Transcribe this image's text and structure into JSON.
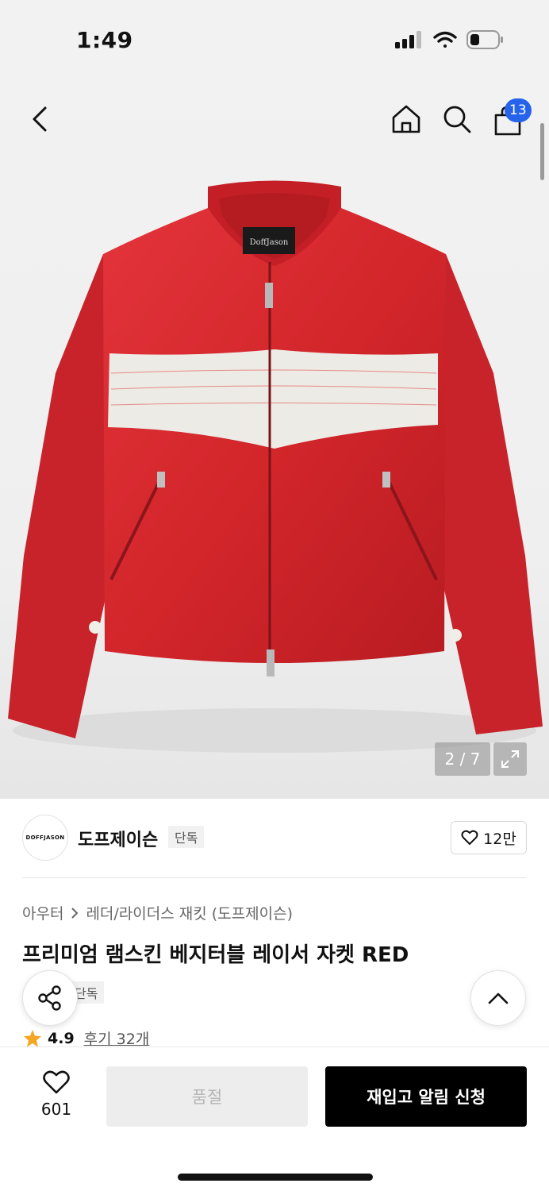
{
  "status_bar": {
    "time": "1:49"
  },
  "nav": {
    "cart_count": "13"
  },
  "gallery": {
    "counter": "2 / 7",
    "jacket_logo": "DoffJason"
  },
  "brand": {
    "logo_text": "DOFFJASON",
    "name": "도프제이슨",
    "tag": "단독",
    "likes": "12만"
  },
  "breadcrumb": {
    "category": "아우터",
    "subcategory": "레더/라이더스 재킷 (도프제이슨)"
  },
  "product": {
    "title": "프리미엄 램스킨 베지터블 레이서 자켓 RED",
    "sub_tag": "단독",
    "rating": "4.9",
    "reviews": "후기 32개"
  },
  "bottom_bar": {
    "wish_count": "601",
    "soldout_label": "품절",
    "restock_label": "재입고 알림 신청"
  },
  "colors": {
    "accent_badge": "#2563eb",
    "jacket_red": "#d4242a",
    "star": "#f5a623"
  },
  "icons": [
    "chevron-left-icon",
    "home-icon",
    "search-icon",
    "shopping-bag-icon",
    "expand-icon",
    "heart-icon",
    "share-icon",
    "chevron-up-icon",
    "star-icon"
  ]
}
